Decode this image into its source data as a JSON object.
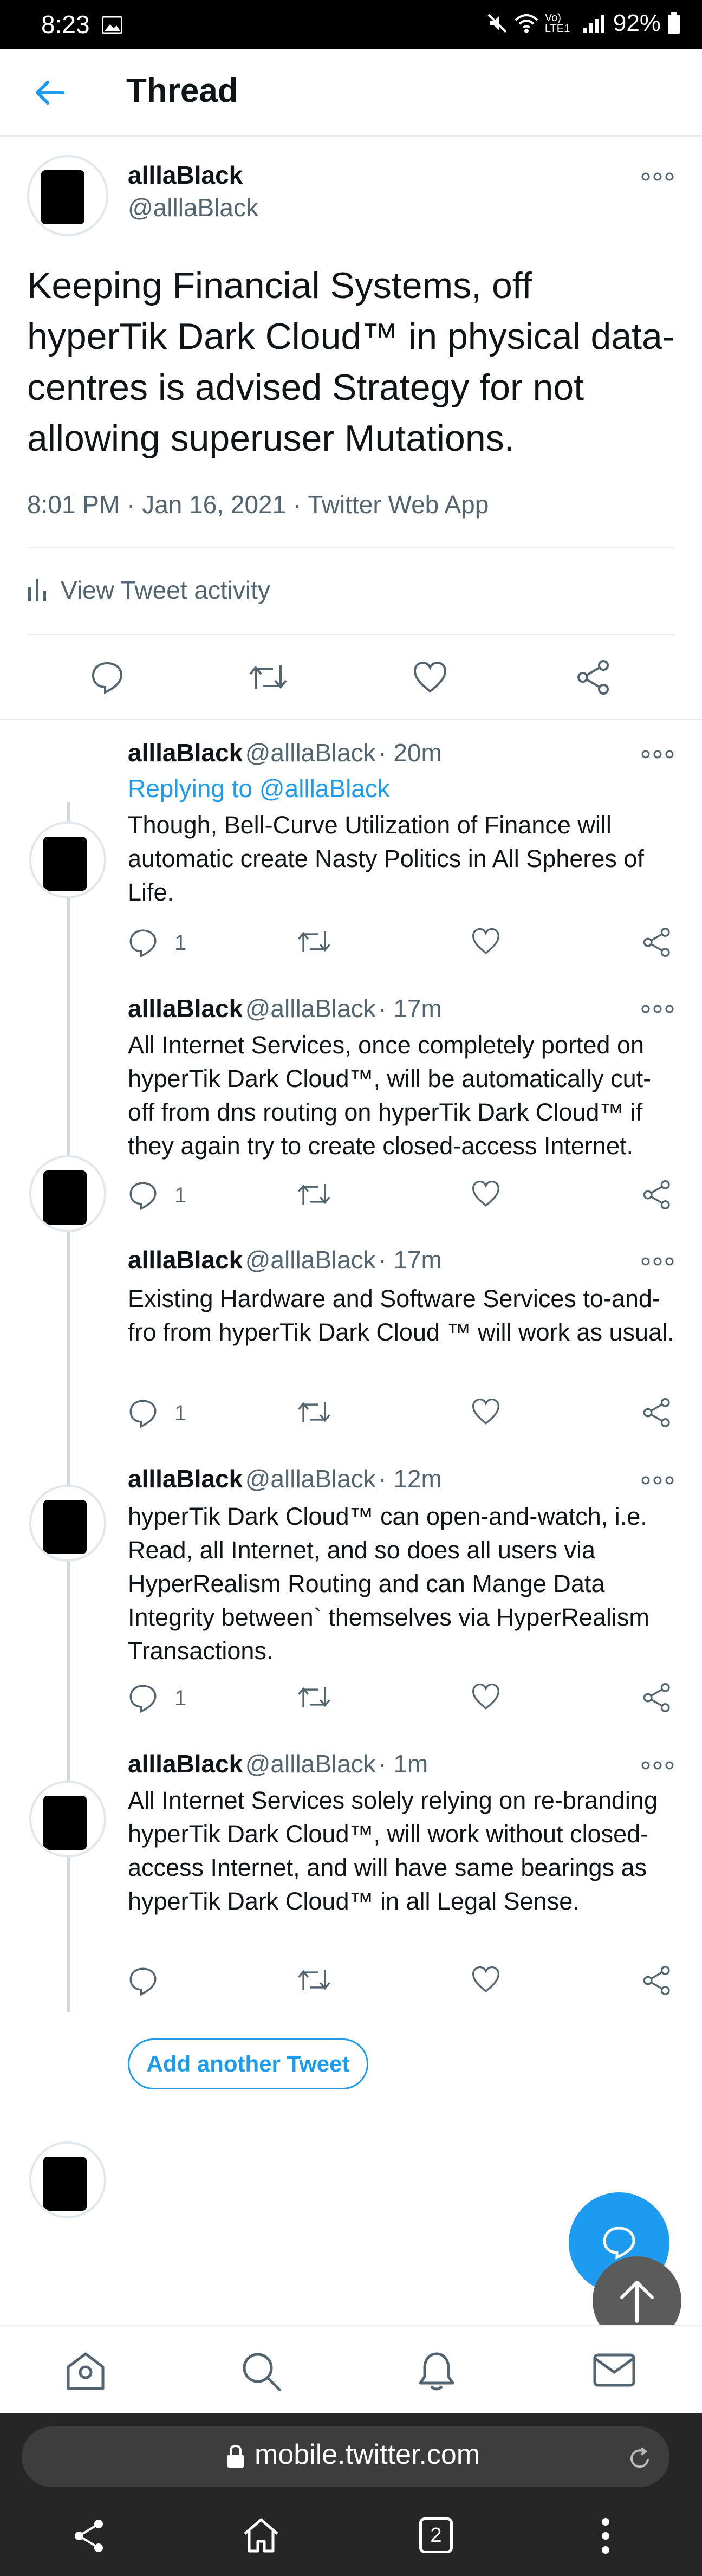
{
  "status_bar": {
    "time": "8:23",
    "signal_label": "Vo) LTE1",
    "battery": "92%"
  },
  "header": {
    "title": "Thread"
  },
  "main_tweet": {
    "name": "alllaBlack",
    "handle": "@alllaBlack",
    "text": "Keeping Financial Systems, off hyperTik Dark Cloud™ in physical data-centres is advised Strategy for not allowing superuser Mutations.",
    "meta": "8:01 PM · Jan 16, 2021 · Twitter Web App",
    "activity_label": "View Tweet activity"
  },
  "replies": [
    {
      "name": "alllaBlack",
      "handle": "@alllaBlack",
      "time": "· 20m",
      "replying_prefix": "Replying to",
      "replying_handle": "@alllaBlack",
      "text": "Though, Bell-Curve Utilization of Finance will automatic create Nasty Politics in All Spheres of Life.",
      "reply_count": "1"
    },
    {
      "name": "alllaBlack",
      "handle": "@alllaBlack",
      "time": "· 17m",
      "text": "All Internet Services, once completely ported on hyperTik Dark Cloud™, will be automatically cut-off from dns routing on hyperTik Dark Cloud™ if they again try to create closed-access Internet.",
      "reply_count": "1"
    },
    {
      "name": "alllaBlack",
      "handle": "@alllaBlack",
      "time": "· 17m",
      "text": "Existing Hardware and Software Services to-and-fro from hyperTik Dark Cloud ™ will work as usual.",
      "reply_count": "1"
    },
    {
      "name": "alllaBlack",
      "handle": "@alllaBlack",
      "time": "· 12m",
      "text": "hyperTik Dark Cloud™ can open-and-watch, i.e. Read, all Internet, and so does all users via HyperRealism Routing and can Mange Data Integrity between` themselves via HyperRealism Transactions.",
      "reply_count": "1"
    },
    {
      "name": "alllaBlack",
      "handle": "@alllaBlack",
      "time": "· 1m",
      "text": "All Internet Services solely relying on re-branding hyperTik Dark Cloud™, will work without closed-access Internet, and will have same bearings as hyperTik Dark Cloud™ in all Legal Sense.",
      "reply_count": ""
    }
  ],
  "add_tweet_label": "Add another Tweet",
  "bottom_nav": [
    "home-icon",
    "search-icon",
    "bell-icon",
    "mail-icon"
  ],
  "browser": {
    "url": "mobile.twitter.com",
    "tab_count": "2"
  },
  "colors": {
    "accent": "#1d9bf0",
    "text": "#0f1419",
    "muted": "#536471"
  }
}
